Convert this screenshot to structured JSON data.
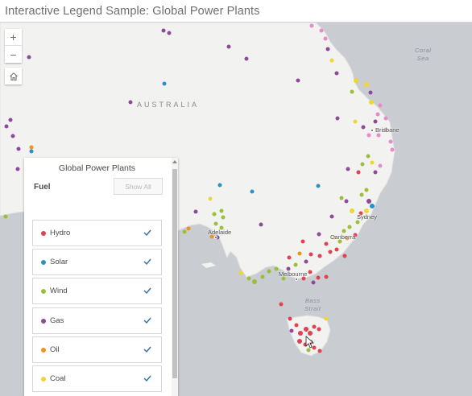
{
  "app": {
    "title": "Interactive Legend Sample: Global Power Plants"
  },
  "map": {
    "labels": {
      "country": "AUSTRALIA",
      "brisbane": "Brisbane",
      "sydney": "Sydney",
      "canberra": "Canberra",
      "adelaide": "Adelaide",
      "melbourne": "Melbourne",
      "coral_sea_1": "Coral",
      "coral_sea_2": "Sea",
      "bass_strait_1": "Bass",
      "bass_strait_2": "Strait"
    },
    "controls": {
      "zoom_in": "+",
      "zoom_out": "−",
      "home_icon": "home-icon"
    },
    "colors": {
      "land": "#f2f2f1",
      "water": "#c9ccd0"
    }
  },
  "legend": {
    "title": "Global Power Plants",
    "field": "Fuel",
    "show_all": "Show All",
    "check_color": "#2a6fa8",
    "items": [
      {
        "label": "Hydro",
        "color": "#e0424f"
      },
      {
        "label": "Solar",
        "color": "#2a93c4"
      },
      {
        "label": "Wind",
        "color": "#9bbf3b"
      },
      {
        "label": "Gas",
        "color": "#8e4a99"
      },
      {
        "label": "Oil",
        "color": "#ee9320"
      },
      {
        "label": "Coal",
        "color": "#f0d633"
      }
    ]
  },
  "other_color": "#e98acb"
}
